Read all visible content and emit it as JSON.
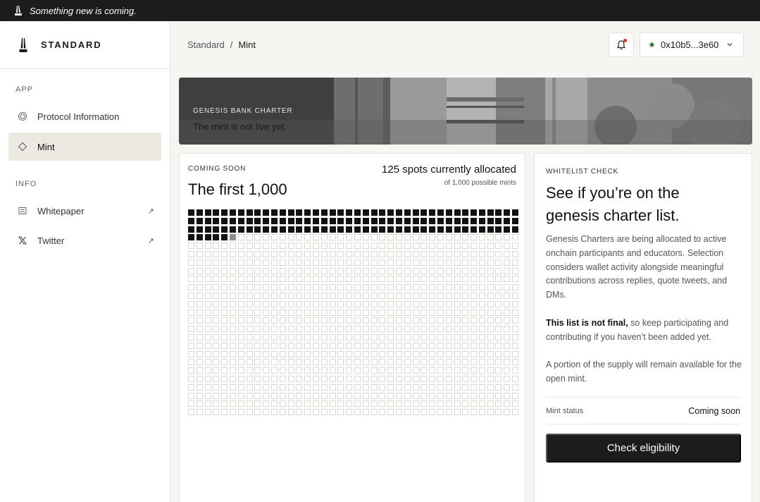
{
  "announcement": {
    "icon": "tower-logo-icon",
    "text": "Something new is coming."
  },
  "brand": {
    "logo": "tower-logo-icon",
    "name": "STANDARD"
  },
  "sidebar": {
    "sections": [
      {
        "label": "APP",
        "items": [
          {
            "label": "Protocol Information",
            "icon": "target-icon",
            "active": false
          },
          {
            "label": "Mint",
            "icon": "diamond-icon",
            "active": true
          }
        ]
      },
      {
        "label": "INFO",
        "items": [
          {
            "label": "Whitepaper",
            "icon": "document-icon",
            "external": true
          },
          {
            "label": "Twitter",
            "icon": "x-logo-icon",
            "external": true
          }
        ]
      }
    ]
  },
  "header": {
    "breadcrumb": {
      "root": "Standard",
      "separator": "/",
      "current": "Mint"
    },
    "notification": {
      "icon": "bell-icon",
      "unread": true
    },
    "wallet": {
      "address": "0x10b5...3e60",
      "status_color": "#2f6b34",
      "icon": "chevron-down-icon"
    }
  },
  "banner": {
    "tag": "GENESIS BANK CHARTER",
    "subtitle": "The mint is not live yet."
  },
  "allocation": {
    "eyebrow": "COMING SOON",
    "title": "The first 1,000",
    "allocated_text": "125 spots currently allocated",
    "possible_text": "of 1,000 possible mints",
    "total": 1000,
    "allocated": 125,
    "pending": 1,
    "columns": 40
  },
  "whitelist": {
    "eyebrow": "WHITELIST CHECK",
    "heading": "See if you’re on the genesis charter list.",
    "para1": "Genesis Charters are being allocated to active onchain participants and educators. Selection considers wallet activity alongside meaningful contributions across replies, quote tweets, and DMs.",
    "para2_bold": "This list is not final,",
    "para2_rest": " so keep participating and contributing if you haven’t been added yet.",
    "para3": "A portion of the supply will remain available for the open mint.",
    "status_label": "Mint status",
    "status_value": "Coming soon",
    "cta": "Check eligibility"
  },
  "colors": {
    "accent": "#1c1c1c",
    "notification_dot": "#d0342c",
    "active_nav_bg": "#ece9e3"
  }
}
